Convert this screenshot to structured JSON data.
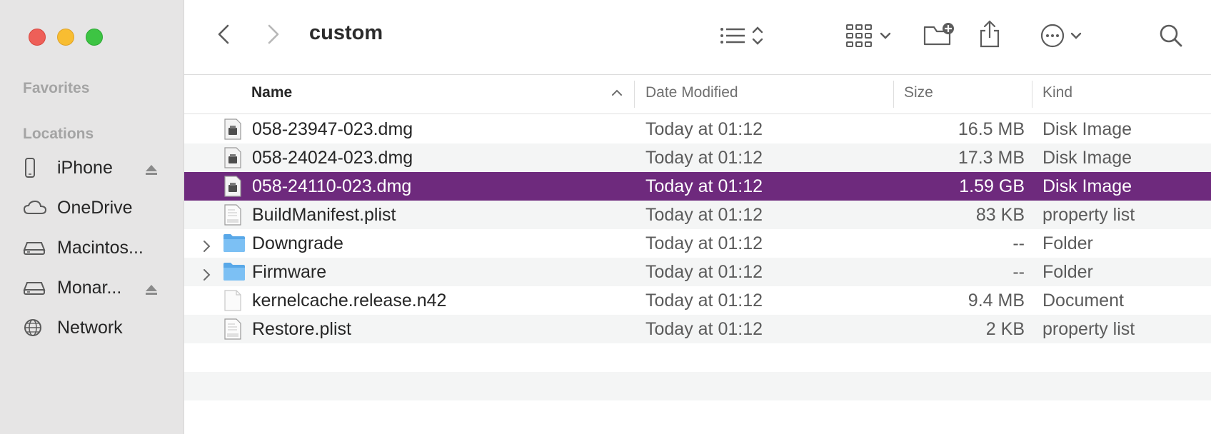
{
  "window": {
    "title": "custom"
  },
  "sidebar": {
    "favorites_title": "Favorites",
    "locations_title": "Locations",
    "items": [
      {
        "label": "iPhone",
        "icon": "iphone-icon",
        "eject": true
      },
      {
        "label": "OneDrive",
        "icon": "cloud-icon",
        "eject": false
      },
      {
        "label": "Macintos...",
        "icon": "hard-drive-icon",
        "eject": false
      },
      {
        "label": "Monar...",
        "icon": "hard-drive-icon",
        "eject": true
      },
      {
        "label": "Network",
        "icon": "network-globe-icon",
        "eject": false
      }
    ]
  },
  "toolbar": {
    "back": "chevron-left-icon",
    "forward": "chevron-right-icon",
    "view": "list-view-icon",
    "group": "group-grid-icon",
    "new_folder": "new-folder-icon",
    "share": "share-icon",
    "more": "more-ellipsis-icon",
    "search": "search-icon"
  },
  "columns": {
    "name": "Name",
    "date": "Date Modified",
    "size": "Size",
    "kind": "Kind"
  },
  "files": [
    {
      "name": "058-23947-023.dmg",
      "date": "Today at 01:12",
      "size": "16.5 MB",
      "kind": "Disk Image",
      "icon": "dmg-icon"
    },
    {
      "name": "058-24024-023.dmg",
      "date": "Today at 01:12",
      "size": "17.3 MB",
      "kind": "Disk Image",
      "icon": "dmg-icon"
    },
    {
      "name": "058-24110-023.dmg",
      "date": "Today at 01:12",
      "size": "1.59 GB",
      "kind": "Disk Image",
      "icon": "dmg-icon",
      "selected": true
    },
    {
      "name": "BuildManifest.plist",
      "date": "Today at 01:12",
      "size": "83 KB",
      "kind": "property list",
      "icon": "plist-icon"
    },
    {
      "name": "Downgrade",
      "date": "Today at 01:12",
      "size": "--",
      "kind": "Folder",
      "icon": "folder-icon"
    },
    {
      "name": "Firmware",
      "date": "Today at 01:12",
      "size": "--",
      "kind": "Folder",
      "icon": "folder-icon"
    },
    {
      "name": "kernelcache.release.n42",
      "date": "Today at 01:12",
      "size": "9.4 MB",
      "kind": "Document",
      "icon": "document-icon"
    },
    {
      "name": "Restore.plist",
      "date": "Today at 01:12",
      "size": "2 KB",
      "kind": "property list",
      "icon": "plist-icon"
    }
  ],
  "colors": {
    "selection": "#6e2a7d",
    "sidebar": "#e6e5e5",
    "folder": "#59a8e8"
  }
}
